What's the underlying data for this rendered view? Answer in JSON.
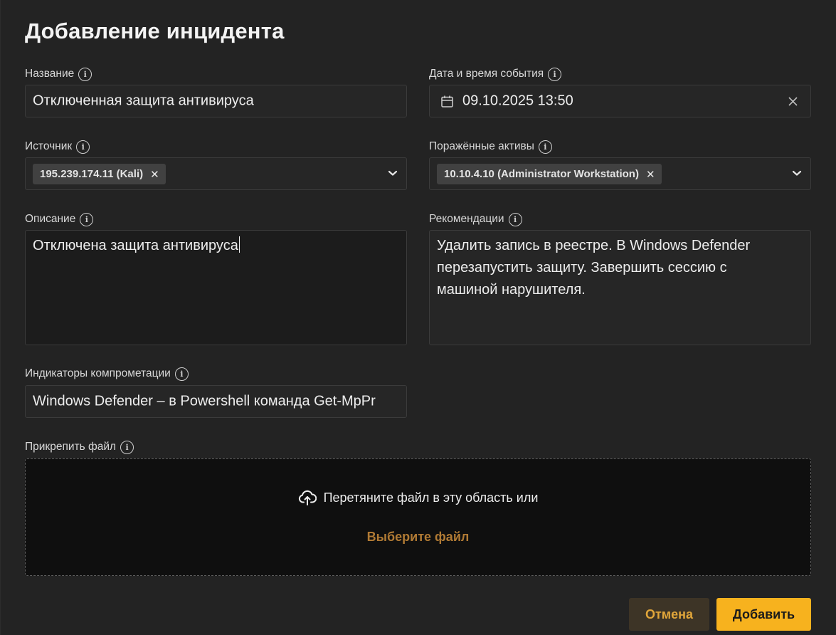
{
  "dialog": {
    "title": "Добавление инцидента"
  },
  "fields": {
    "name": {
      "label": "Название",
      "value": "Отключенная защита антивируса"
    },
    "datetime": {
      "label": "Дата и время события",
      "value": "09.10.2025 13:50"
    },
    "source": {
      "label": "Источник",
      "tag": "195.239.174.11 (Kali)"
    },
    "assets": {
      "label": "Поражённые активы",
      "tag": "10.10.4.10 (Administrator Workstation)"
    },
    "description": {
      "label": "Описание",
      "value": "Отключена защита антивируса"
    },
    "recommendations": {
      "label": "Рекомендации",
      "value": "Удалить запись в реестре. В Windows Defender перезапустить защиту. Завершить сессию с машиной нарушителя."
    },
    "indicators": {
      "label": "Индикаторы компрометации",
      "value": "Windows Defender – в Powershell команда Get-MpPr"
    },
    "attachment": {
      "label": "Прикрепить файл",
      "drop_text": "Перетяните файл в эту область или",
      "choose_link": "Выберите файл"
    }
  },
  "actions": {
    "cancel_label": "Отмена",
    "add_label": "Добавить"
  },
  "colors": {
    "accent": "#f7b21e",
    "link": "#b07a34",
    "background": "#232323"
  },
  "icons": [
    "info-icon",
    "calendar-icon",
    "clear-icon",
    "remove-tag-icon",
    "chevron-down-icon",
    "cloud-upload-icon"
  ]
}
